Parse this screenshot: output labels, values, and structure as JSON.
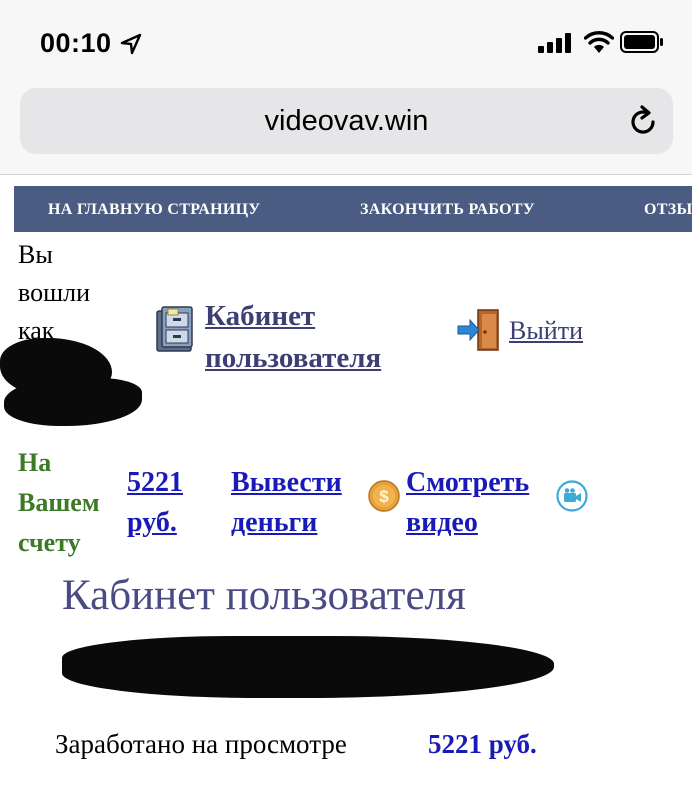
{
  "status_bar": {
    "time": "00:10",
    "icons": [
      "location-arrow-icon",
      "signal-icon",
      "wifi-icon",
      "battery-icon"
    ]
  },
  "browser": {
    "url": "videovav.win",
    "reload_icon": "reload-icon"
  },
  "nav": {
    "items": [
      {
        "label": "НА ГЛАВНУЮ СТРАНИЦУ"
      },
      {
        "label": "ЗАКОНЧИТЬ РАБОТУ"
      },
      {
        "label": "ОТЗЫВЫ"
      }
    ]
  },
  "user": {
    "logged_in_as": "Вы вошли как",
    "cabinet_link": "Кабинет пользователя",
    "logout_link": "Выйти"
  },
  "balance": {
    "label": "На Вашем счету",
    "amount": "5221 руб.",
    "withdraw_link": "Вывести деньги",
    "watch_link": "Смотреть видео"
  },
  "main": {
    "title": "Кабинет пользователя",
    "earned_label": "Заработано на просмотре",
    "earned_value": "5221 руб."
  },
  "colors": {
    "nav_background": "#4b5c82",
    "link_dark": "#3d3f73",
    "link_blue": "#1a1ab8",
    "balance_green": "#3d7a28",
    "title": "#4a4b85"
  }
}
